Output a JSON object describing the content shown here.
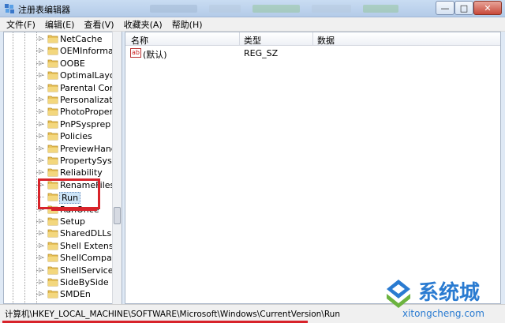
{
  "window": {
    "title": "注册表编辑器",
    "buttons": {
      "minimize": "—",
      "maximize": "□",
      "close": "✕"
    }
  },
  "menu": [
    "文件(F)",
    "编辑(E)",
    "查看(V)",
    "收藏夹(A)",
    "帮助(H)"
  ],
  "tree": {
    "items": [
      {
        "label": "NetCache"
      },
      {
        "label": "OEMInformation"
      },
      {
        "label": "OOBE"
      },
      {
        "label": "OptimalLayout"
      },
      {
        "label": "Parental Controls"
      },
      {
        "label": "Personalization"
      },
      {
        "label": "PhotoPropertyHandler"
      },
      {
        "label": "PnPSysprep"
      },
      {
        "label": "Policies"
      },
      {
        "label": "PreviewHandlers"
      },
      {
        "label": "PropertySystem"
      },
      {
        "label": "Reliability"
      },
      {
        "label": "RenameFiles"
      },
      {
        "label": "Run",
        "selected": true
      },
      {
        "label": "RunOnce"
      },
      {
        "label": "Setup"
      },
      {
        "label": "SharedDLLs"
      },
      {
        "label": "Shell Extensions"
      },
      {
        "label": "ShellCompatibility"
      },
      {
        "label": "ShellServiceObjects"
      },
      {
        "label": "SideBySide"
      },
      {
        "label": "SMDEn"
      }
    ]
  },
  "list": {
    "columns": [
      "名称",
      "类型",
      "数据"
    ],
    "rows": [
      {
        "icon": "ab",
        "name": "(默认)",
        "type": "REG_SZ",
        "data": ""
      }
    ]
  },
  "status": {
    "path": "计算机\\HKEY_LOCAL_MACHINE\\SOFTWARE\\Microsoft\\Windows\\CurrentVersion\\Run"
  },
  "watermark": {
    "brand": "系统城",
    "url": "xitongcheng.com"
  },
  "colors": {
    "highlight": "#d8232a",
    "folder": "#e8c25a",
    "selection": "#cce4f7"
  }
}
